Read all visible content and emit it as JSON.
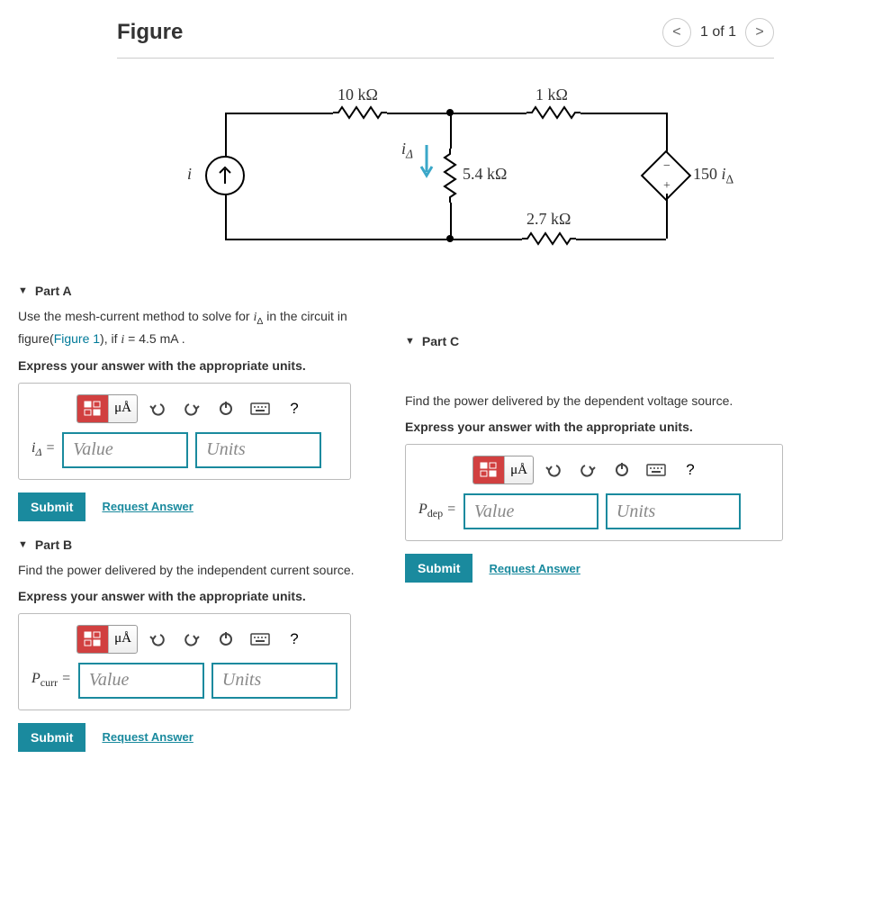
{
  "figure": {
    "title": "Figure",
    "nav_label": "1 of 1",
    "circuit": {
      "r_10k": "10 kΩ",
      "r_1k": "1 kΩ",
      "r_5_4k": "5.4 kΩ",
      "r_2_7k": "2.7 kΩ",
      "i_src": "i",
      "i_delta": "iΔ",
      "dep_src": "150 iΔ"
    }
  },
  "parts": {
    "a": {
      "title": "Part A",
      "prompt_pre": "Use the mesh-current method to solve for iΔ in the circuit in figure(",
      "fig_link": "Figure 1",
      "prompt_post": "), if i = 4.5 mA .",
      "instr": "Express your answer with the appropriate units.",
      "var_html": "iΔ =",
      "value_ph": "Value",
      "units_ph": "Units",
      "submit": "Submit",
      "request": "Request Answer"
    },
    "b": {
      "title": "Part B",
      "prompt": "Find the power delivered by the independent current source.",
      "instr": "Express your answer with the appropriate units.",
      "var_html": "Pcurr =",
      "value_ph": "Value",
      "units_ph": "Units",
      "submit": "Submit",
      "request": "Request Answer"
    },
    "c": {
      "title": "Part C",
      "prompt": "Find the power delivered by the dependent voltage source.",
      "instr": "Express your answer with the appropriate units.",
      "var_html": "Pdep =",
      "value_ph": "Value",
      "units_ph": "Units",
      "submit": "Submit",
      "request": "Request Answer"
    }
  },
  "toolbar": {
    "mu": "μÅ",
    "help": "?"
  }
}
